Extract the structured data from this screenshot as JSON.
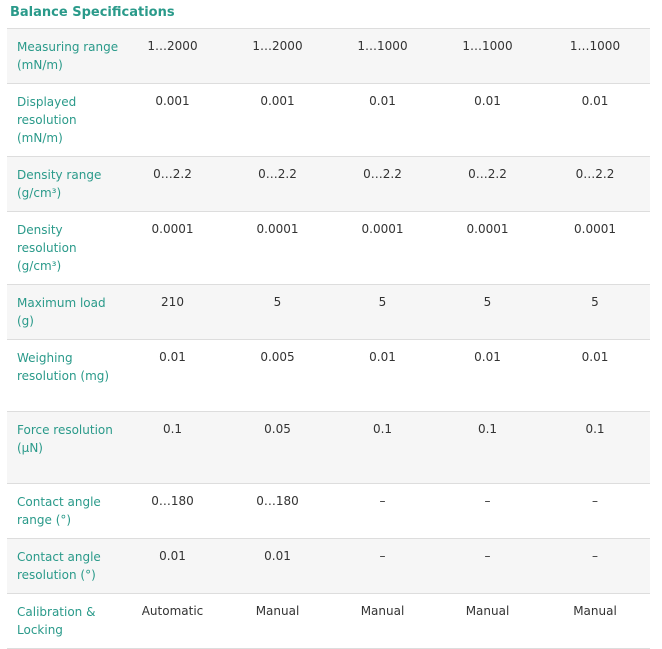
{
  "title": "Balance Specifications",
  "rows": [
    {
      "label": "Measuring range (mN/m)",
      "values": [
        "1…2000",
        "1…2000",
        "1…1000",
        "1…1000",
        "1…1000"
      ]
    },
    {
      "label": "Displayed resolution (mN/m)",
      "values": [
        "0.001",
        "0.001",
        "0.01",
        "0.01",
        "0.01"
      ]
    },
    {
      "label": "Density range (g/cm³)",
      "values": [
        "0…2.2",
        "0…2.2",
        "0…2.2",
        "0…2.2",
        "0…2.2"
      ]
    },
    {
      "label": "Density resolution (g/cm³)",
      "values": [
        "0.0001",
        "0.0001",
        "0.0001",
        "0.0001",
        "0.0001"
      ]
    },
    {
      "label": "Maximum load (g)",
      "values": [
        "210",
        "5",
        "5",
        "5",
        "5"
      ]
    },
    {
      "label": "Weighing resolution (mg)",
      "values": [
        "0.01",
        "0.005",
        "0.01",
        "0.01",
        "0.01"
      ]
    },
    {
      "label": "Force resolution (µN)",
      "values": [
        "0.1",
        "0.05",
        "0.1",
        "0.1",
        "0.1"
      ]
    },
    {
      "label": "Contact angle range (°)",
      "values": [
        "0…180",
        "0…180",
        "–",
        "–",
        "–"
      ]
    },
    {
      "label": "Contact angle resolution (°)",
      "values": [
        "0.01",
        "0.01",
        "–",
        "–",
        "–"
      ]
    },
    {
      "label": "Calibration & Locking",
      "values": [
        "Automatic",
        "Manual",
        "Manual",
        "Manual",
        "Manual"
      ]
    }
  ],
  "colors": {
    "accent": "#2a9a8a",
    "text": "#333333",
    "stripe": "#f6f6f6",
    "rule": "#dddddd"
  }
}
